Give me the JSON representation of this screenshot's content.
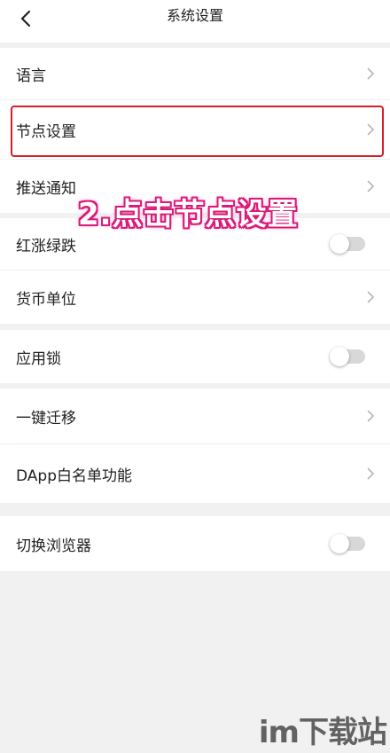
{
  "header": {
    "title": "系统设置",
    "back_icon": "chevron-left-icon"
  },
  "settings": {
    "language": "语言",
    "node": "节点设置",
    "push": "推送通知",
    "red_green": "红涨绿跌",
    "currency": "货币单位",
    "app_lock": "应用锁",
    "migrate": "一键迁移",
    "dapp_whitelist": "DApp白名单功能",
    "switch_browser": "切换浏览器"
  },
  "toggles": {
    "red_green": false,
    "app_lock": false,
    "switch_browser": false
  },
  "annotation": {
    "text": "2.点击节点设置",
    "highlight_color": "#d3202a",
    "text_color": "#d81b79"
  },
  "watermark": {
    "text": "im下载站"
  }
}
